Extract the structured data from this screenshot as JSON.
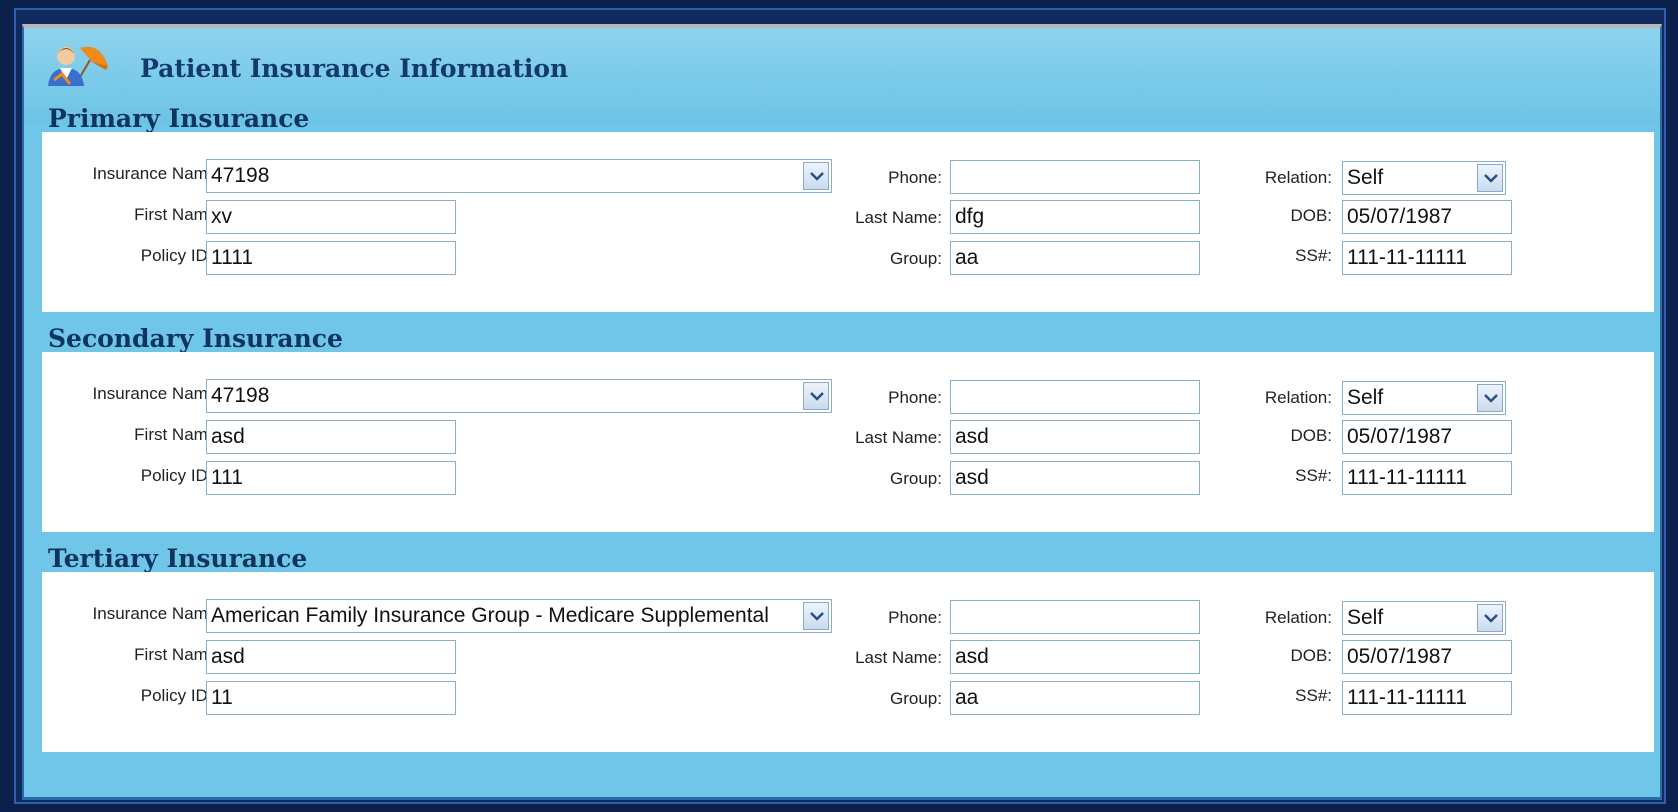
{
  "page": {
    "title": "Patient Insurance Information"
  },
  "labels": {
    "insurance_name": "Insurance Name:",
    "first_name": "First Name:",
    "policy_id": "Policy ID#:",
    "phone": "Phone:",
    "last_name": "Last Name:",
    "group": "Group:",
    "relation": "Relation:",
    "dob": "DOB:",
    "ss": "SS#:"
  },
  "sections": [
    {
      "title": "Primary Insurance",
      "insurance_name": "47198",
      "first_name": "xv",
      "policy_id": "1111",
      "phone": "",
      "last_name": "dfg",
      "group": "aa",
      "relation": "Self",
      "dob": "05/07/1987",
      "ss": "111-11-11111"
    },
    {
      "title": "Secondary Insurance",
      "insurance_name": "47198",
      "first_name": "asd",
      "policy_id": "111",
      "phone": "",
      "last_name": "asd",
      "group": "asd",
      "relation": "Self",
      "dob": "05/07/1987",
      "ss": "111-11-11111"
    },
    {
      "title": "Tertiary Insurance",
      "insurance_name": "American Family Insurance Group - Medicare Supplemental",
      "first_name": "asd",
      "policy_id": "11",
      "phone": "",
      "last_name": "asd",
      "group": "aa",
      "relation": "Self",
      "dob": "05/07/1987",
      "ss": "111-11-11111"
    }
  ],
  "icons": {
    "header_logo": "patient-umbrella-icon",
    "dropdown": "chevron-down-icon"
  },
  "colors": {
    "accent": "#6fc6e8",
    "title": "#123a6a",
    "border": "#2f6aa8"
  }
}
